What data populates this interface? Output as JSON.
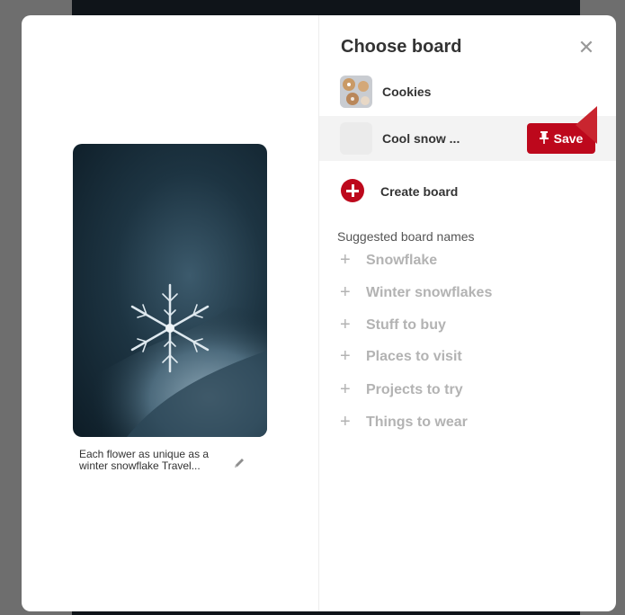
{
  "modal": {
    "title": "Choose board",
    "close_icon": "close-icon"
  },
  "pin": {
    "description": "Each flower as unique as a winter snowflake Travel...",
    "edit_icon": "pencil-icon"
  },
  "boards": [
    {
      "name": "Cookies"
    },
    {
      "name": "Cool snow ...",
      "save_label": "Save",
      "save_icon": "pin-icon"
    }
  ],
  "create_board": {
    "label": "Create board",
    "icon": "plus-circle-icon"
  },
  "suggested": {
    "heading": "Suggested board names",
    "items": [
      "Snowflake",
      "Winter snowflakes",
      "Stuff to buy",
      "Places to visit",
      "Projects to try",
      "Things to wear"
    ]
  },
  "colors": {
    "accent": "#bd081c",
    "pointer_arrow": "#c9252f"
  }
}
